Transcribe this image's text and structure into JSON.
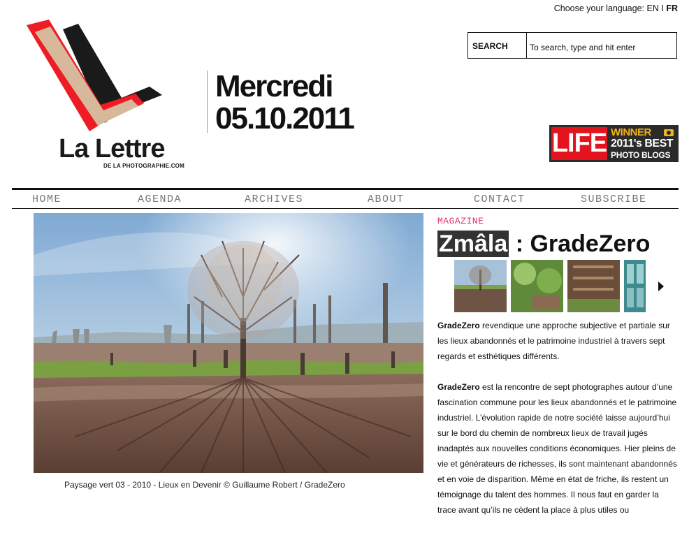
{
  "language": {
    "label": "Choose your language:",
    "en": "EN",
    "sep": "I",
    "fr": "FR"
  },
  "logo": {
    "title": "La Lettre",
    "subtitle": "DE LA PHOTOGRAPHIE.COM"
  },
  "date": {
    "day": "Mercredi",
    "date": "05.10.2011"
  },
  "search": {
    "label": "SEARCH",
    "placeholder": "To search, type and hit enter"
  },
  "life_badge": {
    "brand": "LIFE",
    "winner": "WINNER",
    "line2": "2011's BEST",
    "line3": "PHOTO BLOGS"
  },
  "nav": [
    "HOME",
    "AGENDA",
    "ARCHIVES",
    "ABOUT",
    "CONTACT",
    "SUBSCRIBE"
  ],
  "main_image": {
    "caption": "Paysage vert 03 - 2010 - Lieux en Devenir © Guillaume Robert / GradeZero"
  },
  "article": {
    "kicker": "MAGAZINE",
    "title_highlight": "Zmâla",
    "title_rest": " : GradeZero",
    "para1_bold": "GradeZero",
    "para1": " revendique une approche subjective et partiale sur les lieux abandonnés et le patrimoine industriel à travers sept regards et esthétiques différents.",
    "para2_bold": "GradeZero",
    "para2": " est la rencontre de sept photographes autour d’une fascination commune pour les lieux abandonnés et le patrimoine industriel. L’évolution rapide de notre société laisse aujourd’hui sur le bord du chemin de nombreux lieux de travail jugés inadaptés aux nouvelles conditions économiques. Hier pleins de vie et générateurs de richesses, ils sont maintenant abandonnés et en voie de disparition. Même en état de friche, ils restent un témoignage du talent des hommes. Il nous faut en garder la trace avant qu’ils ne cèdent la place à plus utiles ou"
  },
  "colors": {
    "accent": "#e8316a",
    "life_red": "#e3141d",
    "logo_red": "#ee1c25",
    "logo_tan": "#d8b89a"
  }
}
